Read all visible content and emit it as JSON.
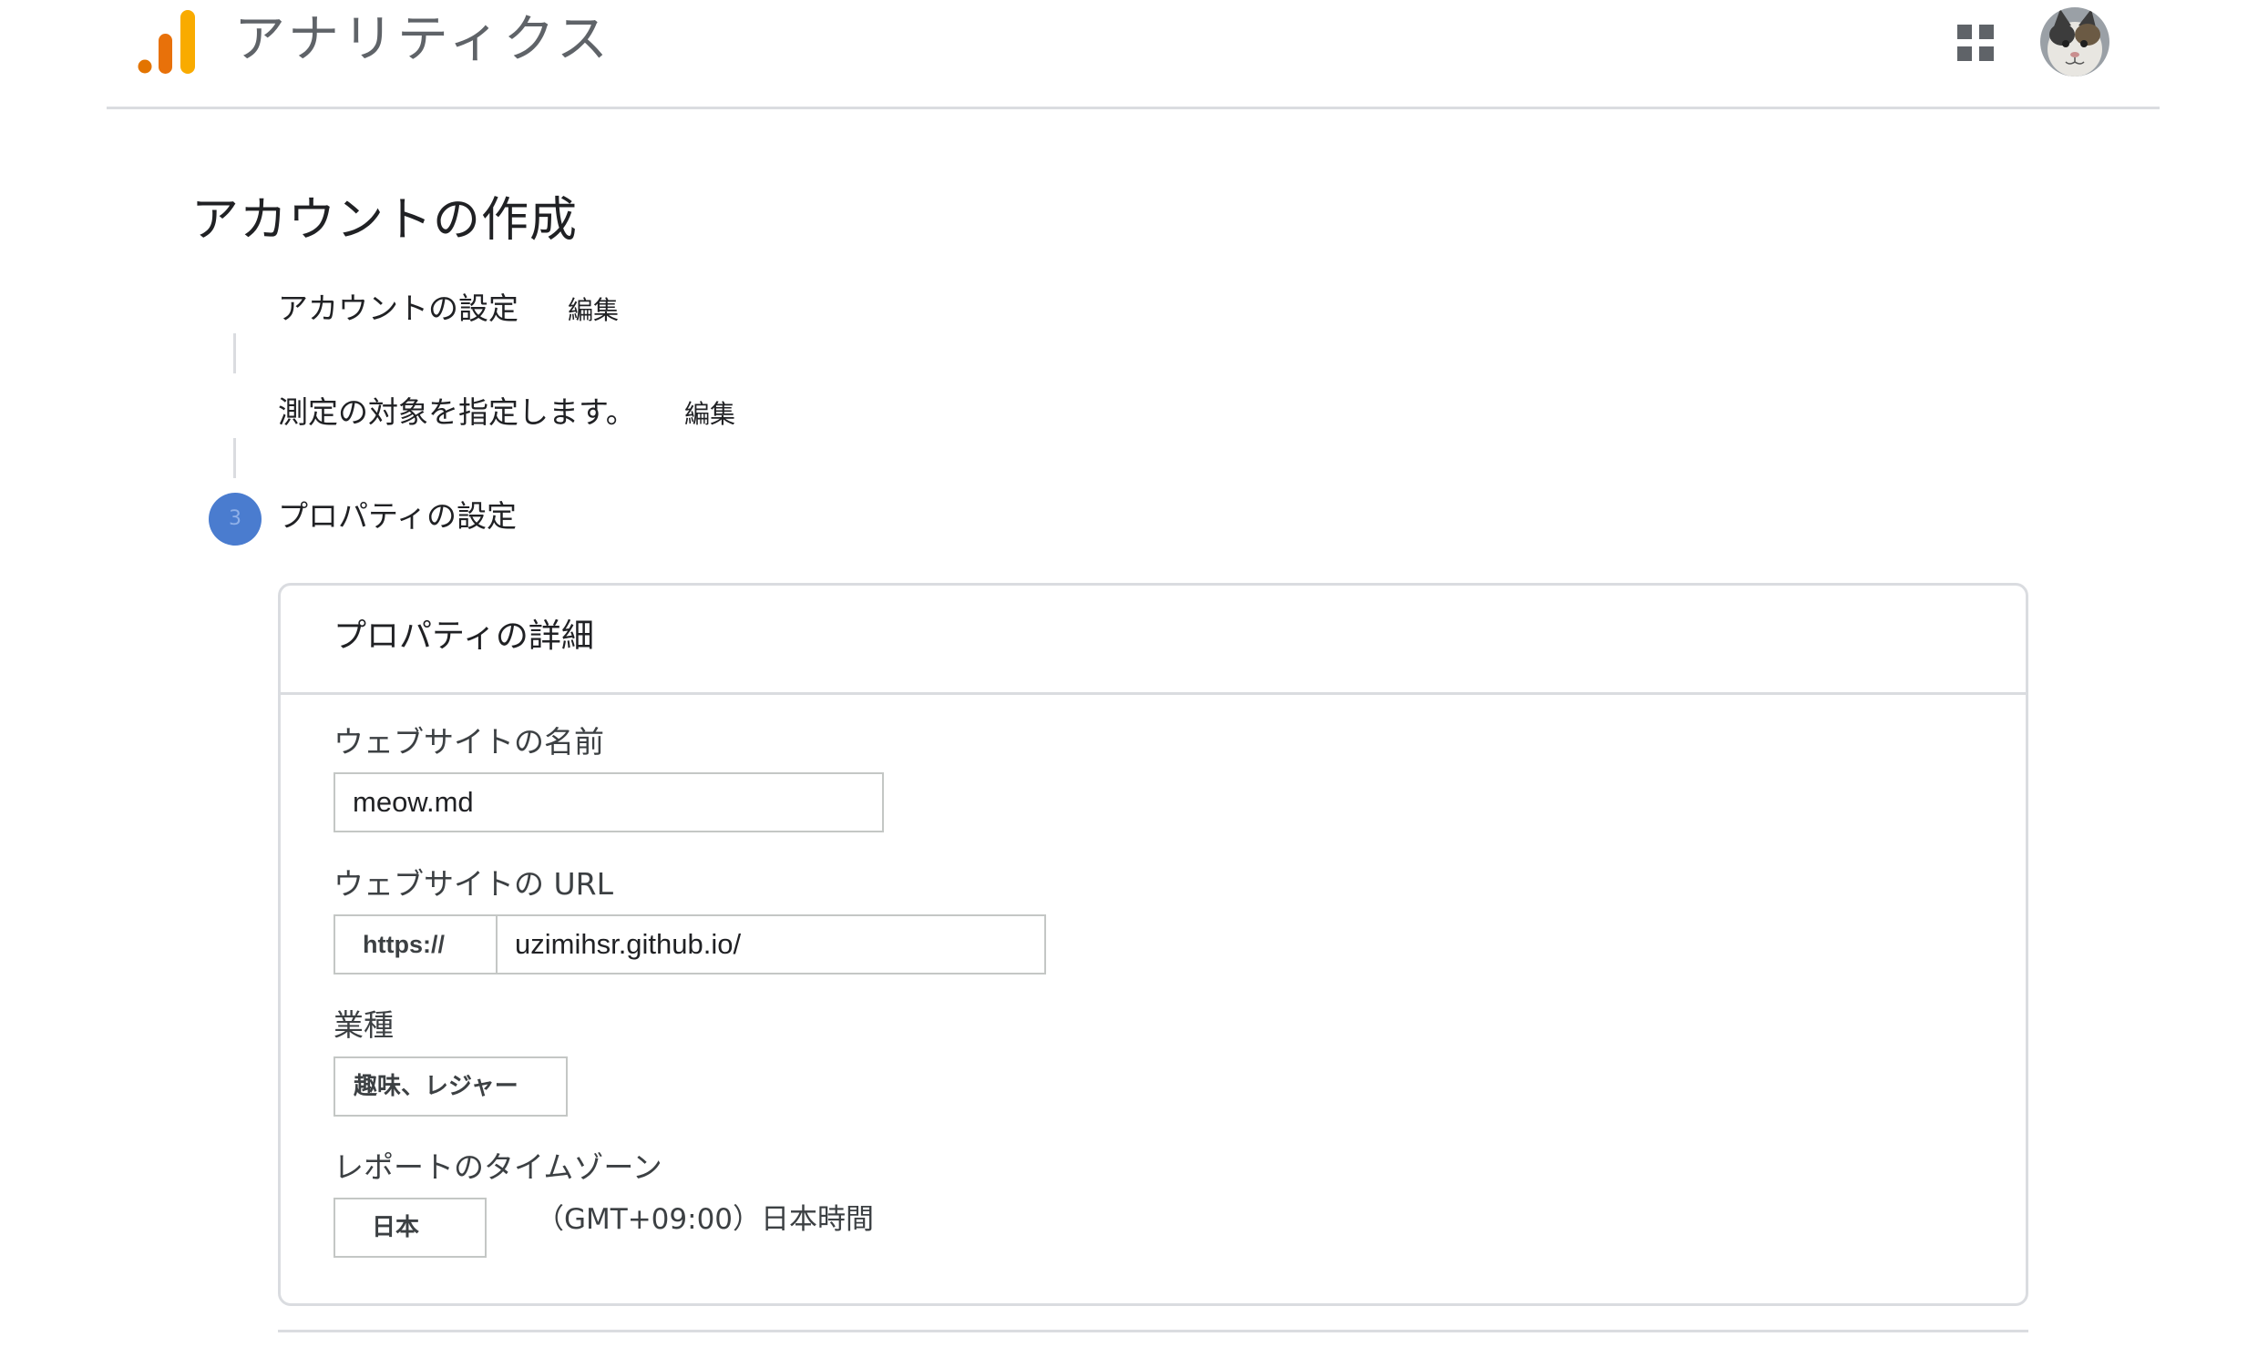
{
  "header": {
    "app_title": "アナリティクス",
    "logo_icon": "analytics-bars-icon",
    "apps_icon": "apps-grid-icon",
    "avatar_icon": "cat-avatar"
  },
  "page": {
    "title": "アカウントの作成"
  },
  "steps": [
    {
      "label": "アカウントの設定",
      "edit_label": "編集"
    },
    {
      "label": "測定の対象を指定します。",
      "edit_label": "編集"
    },
    {
      "number": "3",
      "label": "プロパティの設定"
    }
  ],
  "property_card": {
    "title": "プロパティの詳細",
    "website_name_label": "ウェブサイトの名前",
    "website_name_value": "meow.md",
    "website_url_label": "ウェブサイトの URL",
    "url_protocol": "https://",
    "url_value": "uzimihsr.github.io/",
    "industry_label": "業種",
    "industry_value": "趣味、レジャー",
    "timezone_label": "レポートのタイムゾーン",
    "timezone_country": "日本",
    "timezone_value": "（GMT+09:00）日本時間"
  },
  "colors": {
    "accent": "#4a7ccf",
    "logo_orange": "#e37400",
    "logo_yellow": "#f9ab00",
    "border": "#dadce0"
  }
}
